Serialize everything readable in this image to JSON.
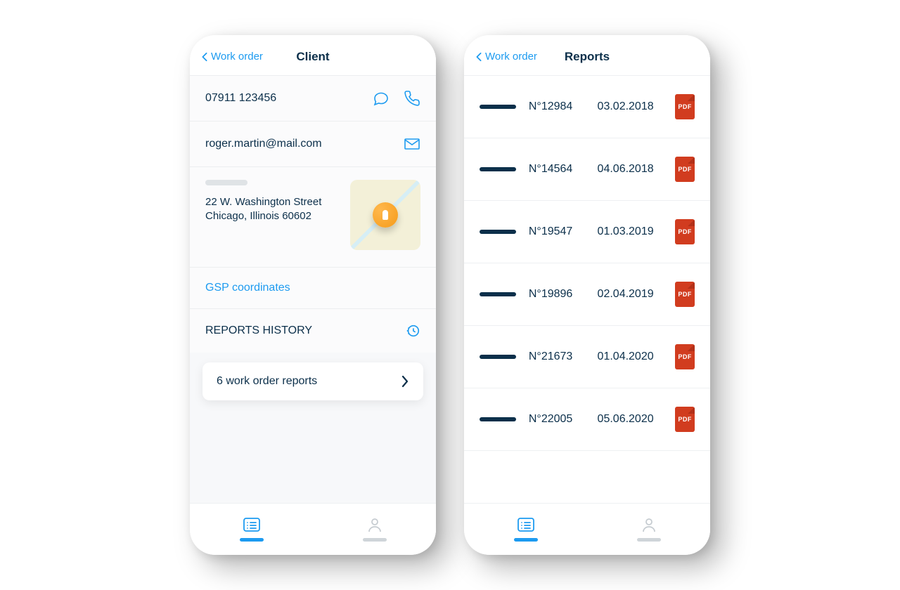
{
  "screens": {
    "client": {
      "back_label": "Work order",
      "title": "Client",
      "phone": "07911 123456",
      "email": "roger.martin@mail.com",
      "address_line1": "22 W. Washington Street",
      "address_line2": "Chicago, Illinois 60602",
      "gsp_link": "GSP coordinates",
      "history_heading": "REPORTS HISTORY",
      "reports_count_label": "6 work order reports"
    },
    "reports": {
      "back_label": "Work order",
      "title": "Reports",
      "list": [
        {
          "number": "N°12984",
          "date": "03.02.2018"
        },
        {
          "number": "N°14564",
          "date": "04.06.2018"
        },
        {
          "number": "N°19547",
          "date": "01.03.2019"
        },
        {
          "number": "N°19896",
          "date": "02.04.2019"
        },
        {
          "number": "N°21673",
          "date": "01.04.2020"
        },
        {
          "number": "N°22005",
          "date": "05.06.2020"
        }
      ],
      "pdf_label": "PDF"
    }
  }
}
